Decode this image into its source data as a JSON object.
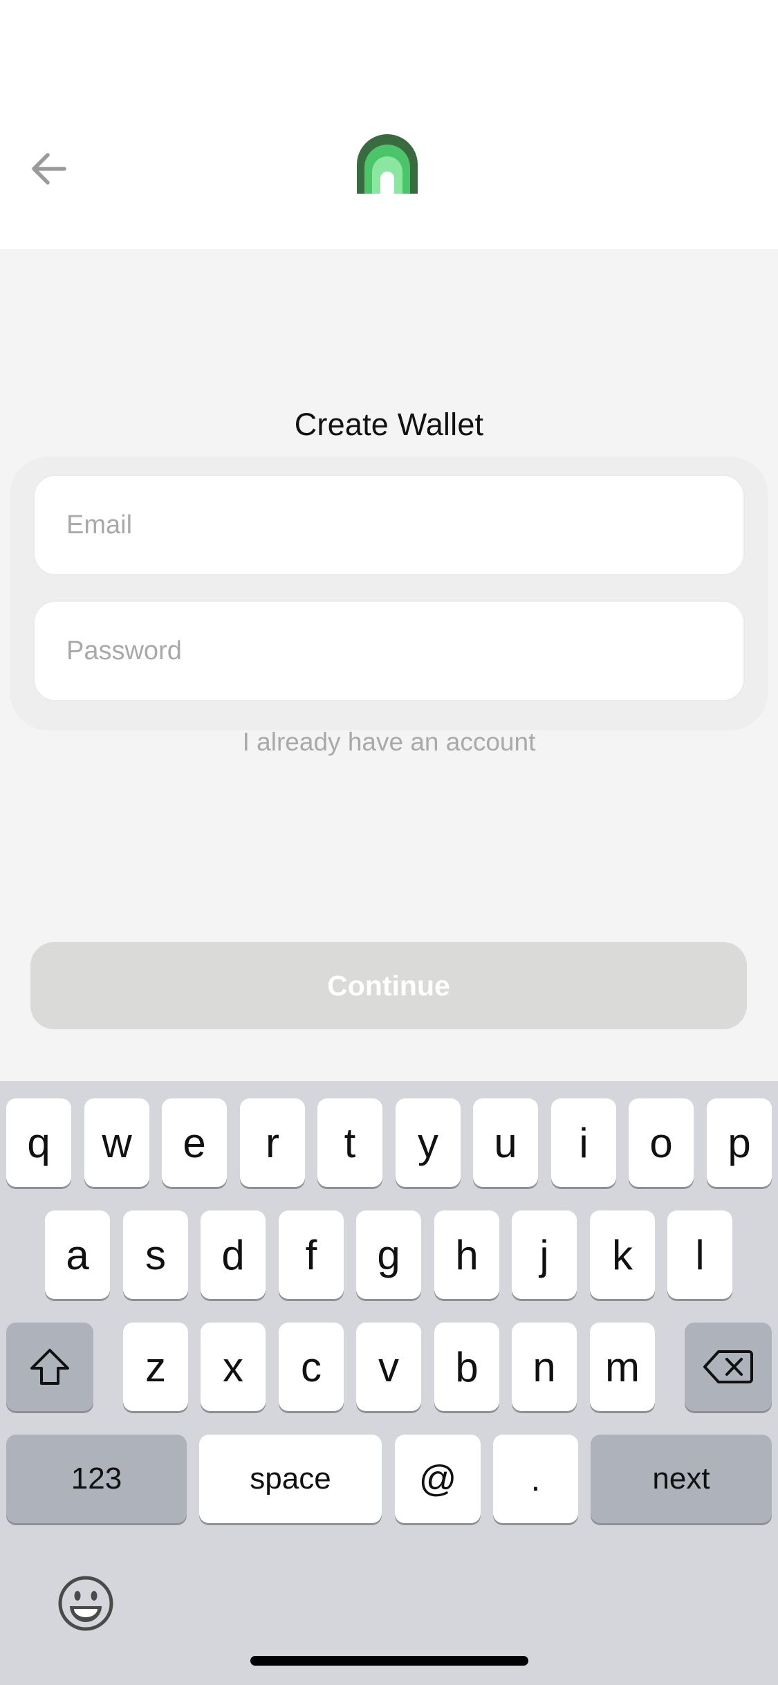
{
  "header": {
    "back_icon": "arrow-left-icon",
    "logo_icon": "wallet-arch-logo-icon"
  },
  "page": {
    "title": "Create Wallet"
  },
  "form": {
    "email_placeholder": "Email",
    "email_value": "",
    "password_placeholder": "Password",
    "password_value": "",
    "login_link": "I already have an account"
  },
  "actions": {
    "continue_label": "Continue"
  },
  "keyboard": {
    "row1": [
      "q",
      "w",
      "e",
      "r",
      "t",
      "y",
      "u",
      "i",
      "o",
      "p"
    ],
    "row2": [
      "a",
      "s",
      "d",
      "f",
      "g",
      "h",
      "j",
      "k",
      "l"
    ],
    "row3": [
      "z",
      "x",
      "c",
      "v",
      "b",
      "n",
      "m"
    ],
    "shift_icon": "shift-icon",
    "delete_icon": "backspace-icon",
    "numbers_label": "123",
    "space_label": "space",
    "at_label": "@",
    "dot_label": ".",
    "next_label": "next",
    "emoji_icon": "emoji-icon"
  },
  "colors": {
    "logo_dark": "#3a6b40",
    "logo_mid": "#4cc46a",
    "logo_light": "#8be6a0",
    "button_disabled": "#dadad9",
    "placeholder": "#a9a9a9"
  }
}
